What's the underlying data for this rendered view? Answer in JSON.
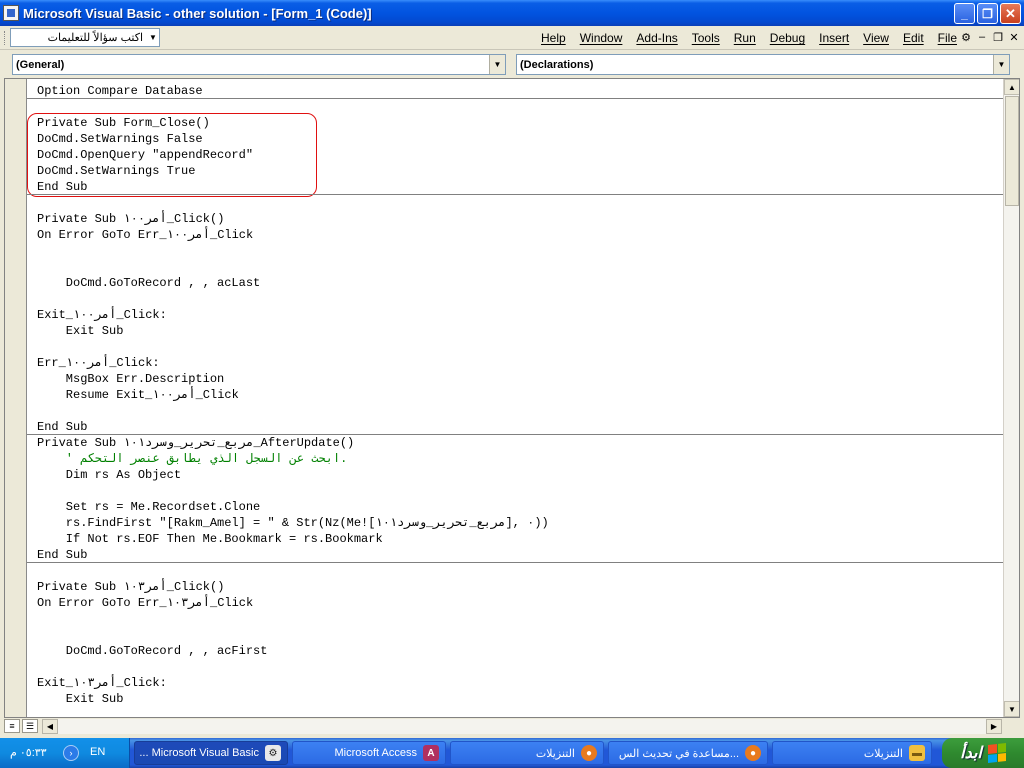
{
  "window": {
    "title": "Microsoft Visual Basic - other solution - [Form_1 (Code)]"
  },
  "menubar": {
    "help_box_text": "اكتب سؤالاً للتعليمات",
    "items": [
      "Help",
      "Window",
      "Add-Ins",
      "Tools",
      "Run",
      "Debug",
      "Insert",
      "View",
      "Edit",
      "File"
    ]
  },
  "combos": {
    "object": "(General)",
    "procedure": "(Declarations)"
  },
  "code_lines": [
    {
      "text": "Option Compare Database",
      "type": "code"
    },
    {
      "text": "Private Sub Form_Close()",
      "type": "code"
    },
    {
      "text": "DoCmd.SetWarnings False",
      "type": "code"
    },
    {
      "text": "DoCmd.OpenQuery \"appendRecord\"",
      "type": "code"
    },
    {
      "text": "DoCmd.SetWarnings True",
      "type": "code"
    },
    {
      "text": "End Sub",
      "type": "code"
    },
    {
      "text": "Private Sub أمر١٠٠_Click()",
      "type": "code"
    },
    {
      "text": "On Error GoTo Err_أمر١٠٠_Click",
      "type": "code"
    },
    {
      "text": "    DoCmd.GoToRecord , , acLast",
      "type": "code"
    },
    {
      "text": "Exit_أمر١٠٠_Click:",
      "type": "code"
    },
    {
      "text": "    Exit Sub",
      "type": "code"
    },
    {
      "text": "Err_أمر١٠٠_Click:",
      "type": "code"
    },
    {
      "text": "    MsgBox Err.Description",
      "type": "code"
    },
    {
      "text": "    Resume Exit_أمر١٠٠_Click",
      "type": "code"
    },
    {
      "text": "End Sub",
      "type": "code"
    },
    {
      "text": "Private Sub مربع_تحرير_وسرد١٠١_AfterUpdate()",
      "type": "code"
    },
    {
      "text": "    ' ابحث عن السجل الذي يطابق عنصر التحكم.",
      "type": "comment"
    },
    {
      "text": "    Dim rs As Object",
      "type": "code"
    },
    {
      "text": "    Set rs = Me.Recordset.Clone",
      "type": "code"
    },
    {
      "text": "    rs.FindFirst \"[Rakm_Amel] = \" & Str(Nz(Me![مربع_تحرير_وسرد١٠١], ٠))",
      "type": "code"
    },
    {
      "text": "    If Not rs.EOF Then Me.Bookmark = rs.Bookmark",
      "type": "code"
    },
    {
      "text": "End Sub",
      "type": "code"
    },
    {
      "text": "Private Sub أمر١٠٣_Click()",
      "type": "code"
    },
    {
      "text": "On Error GoTo Err_أمر١٠٣_Click",
      "type": "code"
    },
    {
      "text": "    DoCmd.GoToRecord , , acFirst",
      "type": "code"
    },
    {
      "text": "Exit_أمر١٠٣_Click:",
      "type": "code"
    },
    {
      "text": "    Exit Sub",
      "type": "code"
    }
  ],
  "taskbar": {
    "clock": "٠٥:٣٣ م",
    "language": "EN",
    "buttons": [
      {
        "label": "... Microsoft Visual Basic",
        "icon": "vb-icon",
        "active": true
      },
      {
        "label": "Microsoft Access",
        "icon": "access-icon",
        "active": false
      },
      {
        "label": "التنزيلات",
        "icon": "firefox-icon",
        "active": false
      },
      {
        "label": "مساعدة في تحديث الس...",
        "icon": "firefox-icon",
        "active": false
      },
      {
        "label": "التنزيلات",
        "icon": "folder-icon",
        "active": false
      }
    ],
    "start_label": "ابدأ"
  }
}
